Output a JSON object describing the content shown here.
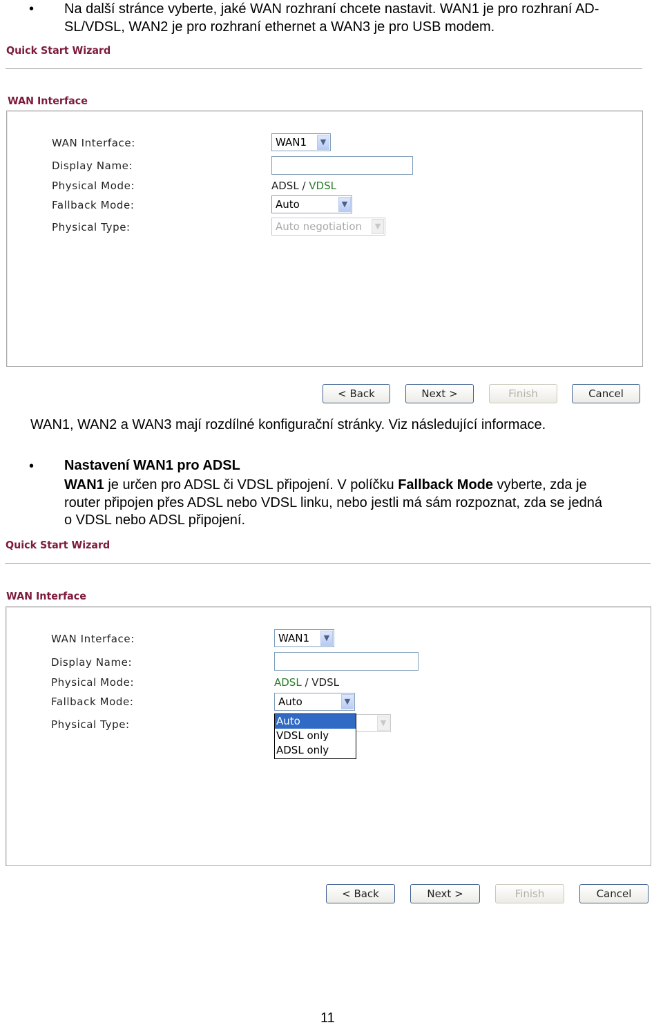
{
  "intro": {
    "bullet_line1": "Na další stránce vyberte, jaké WAN rozhraní chcete nastavit. WAN1 je pro rozhraní AD-",
    "bullet_line2": "SL/VDSL, WAN2 je pro rozhraní ethernet a WAN3 je pro USB modem."
  },
  "wizard1": {
    "title": "Quick Start Wizard",
    "section": "WAN Interface",
    "labels": [
      "WAN Interface:",
      "Display Name:",
      "Physical Mode:",
      "Fallback Mode:",
      "Physical Type:"
    ],
    "wan_interface": "WAN1",
    "display_name": "",
    "physical_mode_a": "ADSL",
    "physical_mode_sep": " / ",
    "physical_mode_b": "VDSL",
    "fallback_mode": "Auto",
    "physical_type": "Auto negotiation",
    "buttons": {
      "back": "< Back",
      "next": "Next >",
      "finish": "Finish",
      "cancel": "Cancel"
    }
  },
  "paragraph1": "WAN1, WAN2 a WAN3 mají rozdílné konfigurační stránky. Viz následující informace.",
  "section2": {
    "heading": "Nastavení WAN1 pro ADSL",
    "l1_b1": "WAN1",
    "l1_t1": " je určen pro ADSL či VDSL připojení. V políčku ",
    "l1_b2": "Fallback Mode",
    "l1_t2": " vyberte, zda je",
    "line2": "router připojen přes ADSL nebo VDSL linku, nebo jestli má sám rozpoznat, zda se jedná",
    "line3": "o VDSL nebo ADSL připojení."
  },
  "wizard2": {
    "title": "Quick Start Wizard",
    "section": "WAN Interface",
    "labels": [
      "WAN Interface:",
      "Display Name:",
      "Physical Mode:",
      "Fallback Mode:",
      "Physical Type:"
    ],
    "wan_interface": "WAN1",
    "display_name": "",
    "physical_mode_a": "ADSL",
    "physical_mode_sep": " / ",
    "physical_mode_b": "VDSL",
    "fallback_mode": "Auto",
    "physical_type_partial": "on",
    "fallback_options": [
      "Auto",
      "VDSL only",
      "ADSL only"
    ],
    "buttons": {
      "back": "< Back",
      "next": "Next >",
      "finish": "Finish",
      "cancel": "Cancel"
    }
  },
  "page_number": "11"
}
